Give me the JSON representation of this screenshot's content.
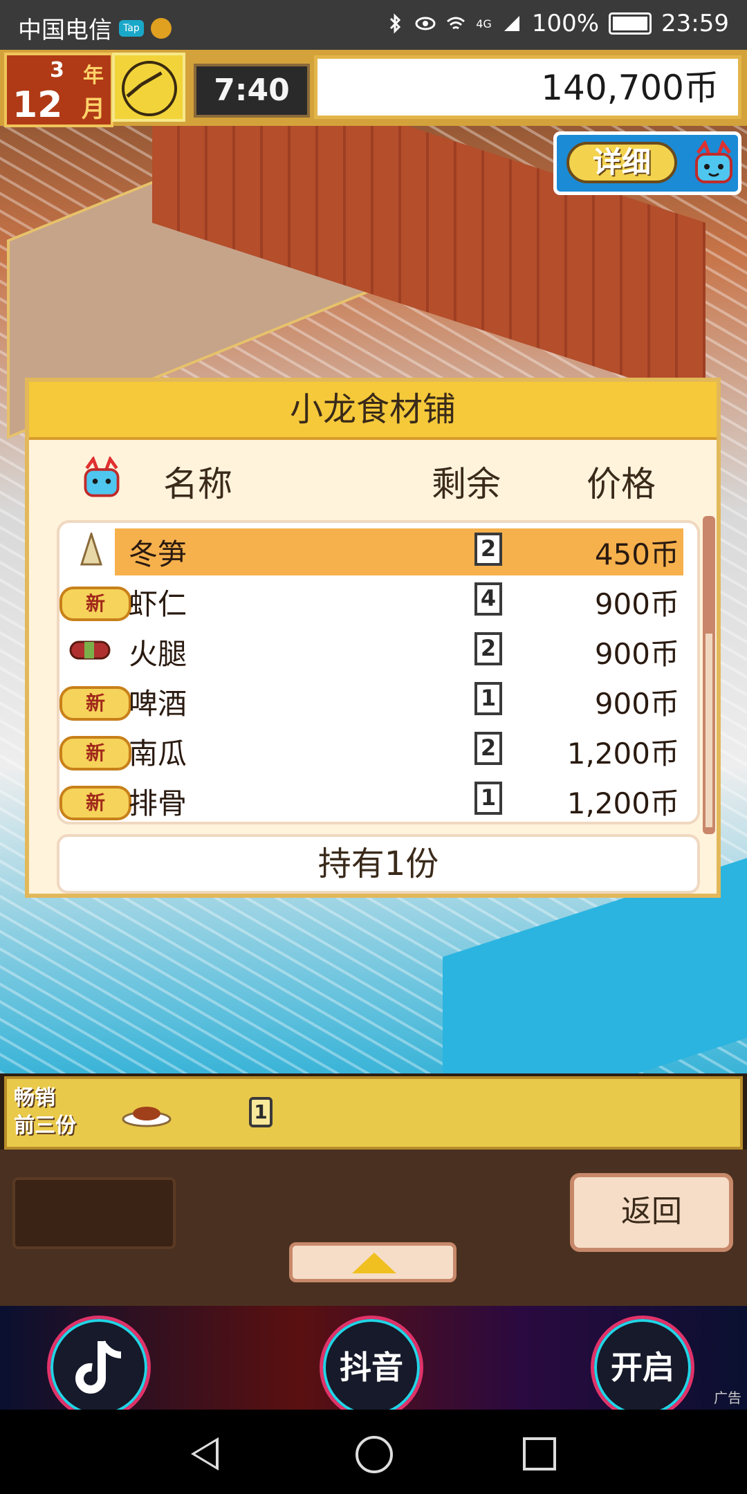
{
  "status_bar": {
    "carrier": "中国电信",
    "tap_badge": "Tap",
    "battery": "100%",
    "network": "4G",
    "time": "23:59"
  },
  "hud": {
    "year": "3",
    "year_unit": "年",
    "month": "12",
    "month_unit": "月",
    "game_time": "7:40",
    "money": "140,700币",
    "detail_button": "详细"
  },
  "shop": {
    "title": "小龙食材铺",
    "columns": {
      "name": "名称",
      "remaining": "剩余",
      "price": "价格"
    },
    "items": [
      {
        "name": "冬笋",
        "remaining": "2",
        "price": "450币",
        "is_new": false,
        "selected": true,
        "icon": "bamboo-shoot-icon"
      },
      {
        "name": "虾仁",
        "remaining": "4",
        "price": "900币",
        "is_new": true,
        "selected": false,
        "icon": "shrimp-icon"
      },
      {
        "name": "火腿",
        "remaining": "2",
        "price": "900币",
        "is_new": false,
        "selected": false,
        "icon": "ham-icon"
      },
      {
        "name": "啤酒",
        "remaining": "1",
        "price": "900币",
        "is_new": true,
        "selected": false,
        "icon": "beer-icon"
      },
      {
        "name": "南瓜",
        "remaining": "2",
        "price": "1,200币",
        "is_new": true,
        "selected": false,
        "icon": "pumpkin-icon"
      },
      {
        "name": "排骨",
        "remaining": "1",
        "price": "1,200币",
        "is_new": true,
        "selected": false,
        "icon": "ribs-icon"
      }
    ],
    "new_label": "新",
    "owned": "持有1份"
  },
  "bestseller": {
    "label_line1": "畅销",
    "label_line2": "前三份",
    "count": "1",
    "icon": "dish-icon"
  },
  "controls": {
    "back_button": "返回",
    "up_icon": "triangle-up-icon"
  },
  "ad": {
    "left_icon": "tiktok-logo-icon",
    "center_label": "抖音",
    "right_label": "开启",
    "tag": "广告"
  },
  "colors": {
    "panel_bg": "#fff3dc",
    "title_bar": "#f5c93a",
    "selected_row": "#f6b14d",
    "hud_gold": "#d4a23b"
  }
}
